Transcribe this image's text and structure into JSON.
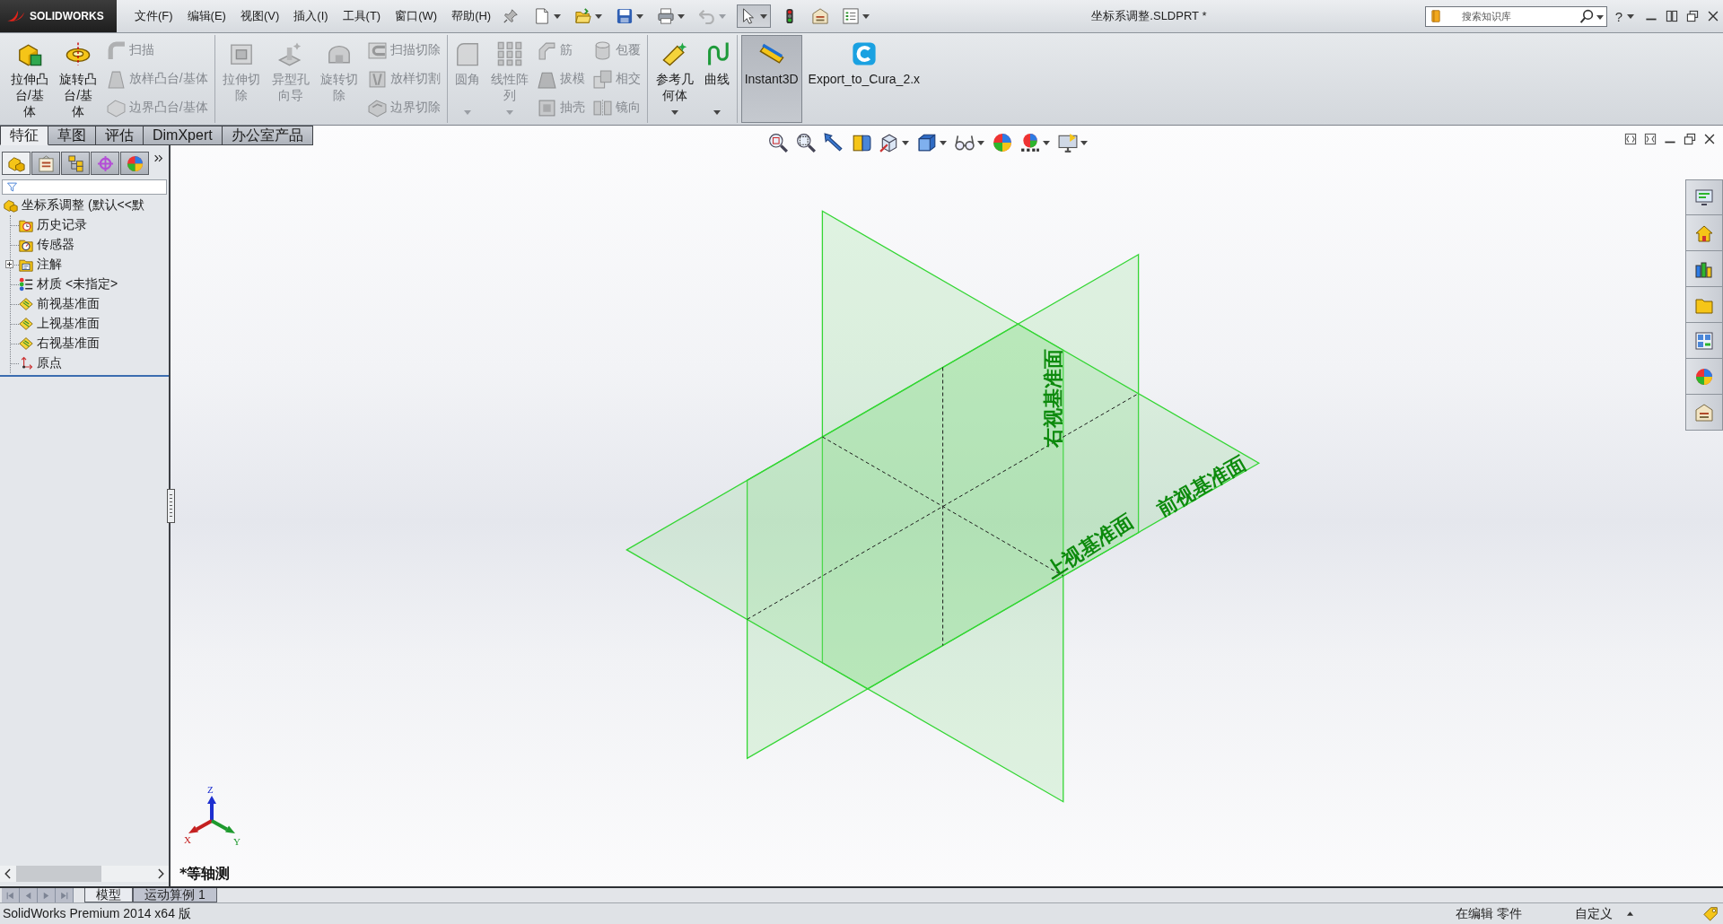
{
  "title_bar": {
    "logo": "SOLIDWORKS",
    "menus": [
      "文件(F)",
      "编辑(E)",
      "视图(V)",
      "插入(I)",
      "工具(T)",
      "窗口(W)",
      "帮助(H)"
    ],
    "quick_access": [
      {
        "dropdown": true,
        "pressed": false,
        "disabled": false
      },
      {
        "dropdown": true,
        "pressed": false,
        "disabled": false
      },
      {
        "dropdown": true,
        "pressed": false,
        "disabled": false
      },
      {
        "dropdown": true,
        "pressed": false,
        "disabled": false
      },
      {
        "dropdown": true,
        "pressed": false,
        "disabled": true
      },
      {
        "dropdown": true,
        "pressed": true,
        "disabled": false
      },
      {
        "dropdown": false,
        "pressed": false,
        "disabled": false
      },
      {
        "dropdown": false,
        "pressed": false,
        "disabled": false
      },
      {
        "dropdown": true,
        "pressed": false,
        "disabled": false
      }
    ],
    "title": "坐标系调整.SLDPRT *",
    "search": {
      "placeholder": "搜索知识库"
    },
    "help": "?"
  },
  "ribbon": {
    "groups": [
      [
        {
          "kind": "large",
          "label": "拉伸凸台/基体",
          "disabled": false,
          "dropdown": false,
          "pressed": false
        },
        {
          "kind": "large",
          "label": "旋转凸台/基体",
          "disabled": false,
          "dropdown": false,
          "pressed": false
        },
        {
          "kind": "stack",
          "items": [
            {
              "label": "扫描",
              "disabled": true
            },
            {
              "label": "放样凸台/基体",
              "disabled": true
            },
            {
              "label": "边界凸台/基体",
              "disabled": true
            }
          ]
        }
      ],
      [
        {
          "kind": "large",
          "label": "拉伸切除",
          "disabled": true,
          "dropdown": false,
          "pressed": false
        },
        {
          "kind": "large",
          "label": "异型孔向导",
          "disabled": true,
          "dropdown": false,
          "pressed": false
        },
        {
          "kind": "large",
          "label": "旋转切除",
          "disabled": true,
          "dropdown": false,
          "pressed": false
        },
        {
          "kind": "stack",
          "items": [
            {
              "label": "扫描切除",
              "disabled": true
            },
            {
              "label": "放样切割",
              "disabled": true
            },
            {
              "label": "边界切除",
              "disabled": true
            }
          ]
        }
      ],
      [
        {
          "kind": "large",
          "label": "圆角",
          "disabled": true,
          "dropdown": true,
          "pressed": false
        },
        {
          "kind": "large",
          "label": "线性阵列",
          "disabled": true,
          "dropdown": true,
          "pressed": false
        },
        {
          "kind": "stack",
          "items": [
            {
              "label": "筋",
              "disabled": true
            },
            {
              "label": "拔模",
              "disabled": true
            },
            {
              "label": "抽壳",
              "disabled": true
            }
          ]
        },
        {
          "kind": "stack",
          "items": [
            {
              "label": "包覆",
              "disabled": true
            },
            {
              "label": "相交",
              "disabled": true
            },
            {
              "label": "镜向",
              "disabled": true
            }
          ]
        }
      ],
      [
        {
          "kind": "large",
          "label": "参考几何体",
          "disabled": false,
          "dropdown": true,
          "pressed": false
        },
        {
          "kind": "large",
          "label": "曲线",
          "disabled": false,
          "dropdown": true,
          "pressed": false
        }
      ],
      [
        {
          "kind": "large",
          "label": "Instant3D",
          "disabled": false,
          "dropdown": false,
          "pressed": true
        },
        {
          "kind": "large",
          "label": "Export_to_Cura_2.x",
          "disabled": false,
          "dropdown": false,
          "pressed": false
        }
      ]
    ]
  },
  "command_tabs": [
    {
      "label": "特征",
      "selected": true
    },
    {
      "label": "草图",
      "selected": false
    },
    {
      "label": "评估",
      "selected": false
    },
    {
      "label": "DimXpert",
      "selected": false
    },
    {
      "label": "办公室产品",
      "selected": false
    }
  ],
  "feature_manager": {
    "tabs": [
      {
        "selected": true
      },
      {
        "selected": false
      },
      {
        "selected": false
      },
      {
        "selected": false
      },
      {
        "selected": false
      }
    ],
    "tree": {
      "label": "坐标系调整 (默认<<默",
      "children": [
        {
          "label": "历史记录",
          "kind": "history",
          "collapsed": false
        },
        {
          "label": "传感器",
          "kind": "sensors",
          "collapsed": false
        },
        {
          "label": "注解",
          "kind": "annotations",
          "collapsed": true
        },
        {
          "label": "材质 <未指定>",
          "kind": "material",
          "collapsed": false
        },
        {
          "label": "前视基准面",
          "kind": "plane",
          "collapsed": false
        },
        {
          "label": "上视基准面",
          "kind": "plane",
          "collapsed": false
        },
        {
          "label": "右视基准面",
          "kind": "plane",
          "collapsed": false
        },
        {
          "label": "原点",
          "kind": "origin",
          "collapsed": false
        }
      ]
    }
  },
  "viewport": {
    "view_toolbar": [
      {
        "dropdown": false
      },
      {
        "dropdown": false
      },
      {
        "dropdown": false
      },
      {
        "dropdown": false
      },
      {
        "dropdown": true
      },
      {
        "dropdown": true
      },
      {
        "dropdown": true
      },
      {
        "dropdown": false
      },
      {
        "dropdown": true
      },
      {
        "dropdown": true
      }
    ],
    "plane_labels": [
      "右视基准面",
      "上视基准面",
      "前视基准面"
    ],
    "triad": [
      "X",
      "Y",
      "Z"
    ],
    "view_name": "*等轴测"
  },
  "bottom_tabs": [
    {
      "label": "模型",
      "selected": true
    },
    {
      "label": "运动算例 1",
      "selected": false
    }
  ],
  "status_bar": {
    "product": "SolidWorks Premium 2014 x64 版",
    "mode": "在编辑 零件",
    "units": "自定义"
  }
}
